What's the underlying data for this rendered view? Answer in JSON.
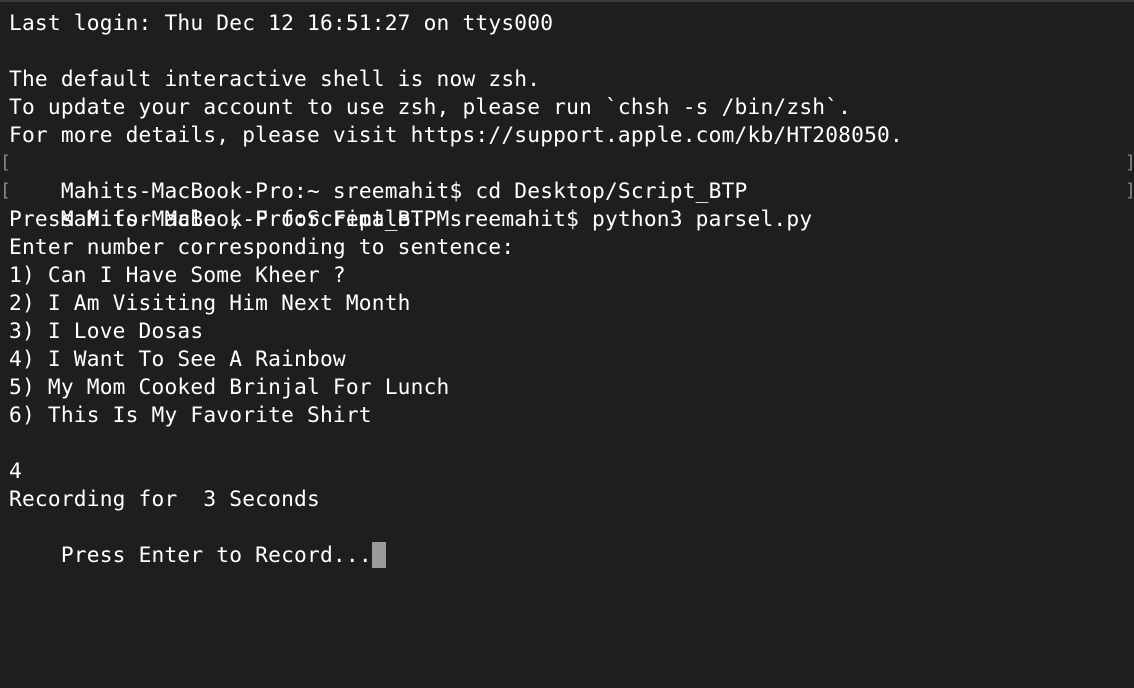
{
  "terminal": {
    "lines": [
      "Last login: Thu Dec 12 16:51:27 on ttys000",
      "",
      "The default interactive shell is now zsh.",
      "To update your account to use zsh, please run `chsh -s /bin/zsh`.",
      "For more details, please visit https://support.apple.com/kb/HT208050.",
      "Mahits-MacBook-Pro:~ sreemahit$ cd Desktop/Script_BTP",
      "Mahits-MacBook-Pro:Script_BTP sreemahit$ python3 parsel.py",
      "Press M for Male , F for Female: M",
      "Enter number corresponding to sentence:",
      "1) Can I Have Some Kheer ?",
      "2) I Am Visiting Him Next Month",
      "3) I Love Dosas",
      "4) I Want To See A Rainbow",
      "5) My Mom Cooked Brinjal For Lunch",
      "6) This Is My Favorite Shirt",
      "",
      "4",
      "Recording for  3 Seconds",
      "Press Enter to Record..."
    ],
    "colors": {
      "background": "#1e1e1e",
      "text": "#ffffff",
      "cursor": "#9a9a9a"
    }
  }
}
